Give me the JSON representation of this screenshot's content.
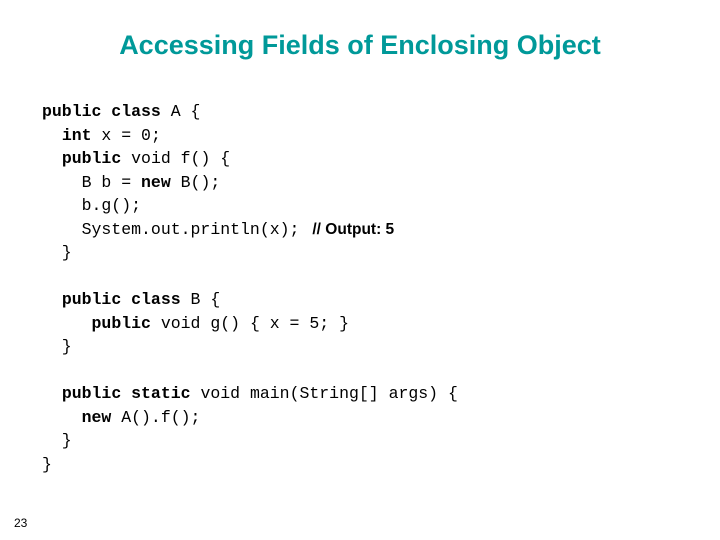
{
  "slide": {
    "title": "Accessing Fields of Enclosing Object",
    "number": "23",
    "title_color": "#009999",
    "code_lines": [
      {
        "id": "l1",
        "segments": [
          {
            "t": "public class",
            "b": true
          },
          {
            "t": " A {",
            "b": false
          }
        ]
      },
      {
        "id": "l2",
        "segments": [
          {
            "t": "  ",
            "b": false
          },
          {
            "t": "int",
            "b": true
          },
          {
            "t": " x = 0;",
            "b": false
          }
        ]
      },
      {
        "id": "l3",
        "segments": [
          {
            "t": "  ",
            "b": false
          },
          {
            "t": "public",
            "b": true
          },
          {
            "t": " void f() {",
            "b": false
          }
        ]
      },
      {
        "id": "l4",
        "segments": [
          {
            "t": "    B b = ",
            "b": false
          },
          {
            "t": "new",
            "b": true
          },
          {
            "t": " B();",
            "b": false
          }
        ]
      },
      {
        "id": "l5",
        "segments": [
          {
            "t": "    b.g();",
            "b": false
          }
        ]
      },
      {
        "id": "l6",
        "segments": [
          {
            "t": "    System.out.println(x);",
            "b": false
          }
        ],
        "comment": "// Output: 5"
      },
      {
        "id": "l7",
        "segments": [
          {
            "t": "  }",
            "b": false
          }
        ]
      },
      {
        "id": "l8",
        "segments": [
          {
            "t": "",
            "b": false
          }
        ]
      },
      {
        "id": "l9",
        "segments": [
          {
            "t": "  ",
            "b": false
          },
          {
            "t": "public class",
            "b": true
          },
          {
            "t": " B {",
            "b": false
          }
        ]
      },
      {
        "id": "l10",
        "segments": [
          {
            "t": "     ",
            "b": false
          },
          {
            "t": "public",
            "b": true
          },
          {
            "t": " void g() { x = 5; }",
            "b": false
          }
        ]
      },
      {
        "id": "l11",
        "segments": [
          {
            "t": "  }",
            "b": false
          }
        ]
      },
      {
        "id": "l12",
        "segments": [
          {
            "t": "",
            "b": false
          }
        ]
      },
      {
        "id": "l13",
        "segments": [
          {
            "t": "  ",
            "b": false
          },
          {
            "t": "public static",
            "b": true
          },
          {
            "t": " void main(String[] args) {",
            "b": false
          }
        ]
      },
      {
        "id": "l14",
        "segments": [
          {
            "t": "    ",
            "b": false
          },
          {
            "t": "new",
            "b": true
          },
          {
            "t": " A().f();",
            "b": false
          }
        ]
      },
      {
        "id": "l15",
        "segments": [
          {
            "t": "  }",
            "b": false
          }
        ]
      },
      {
        "id": "l16",
        "segments": [
          {
            "t": "}",
            "b": false
          }
        ]
      }
    ]
  }
}
